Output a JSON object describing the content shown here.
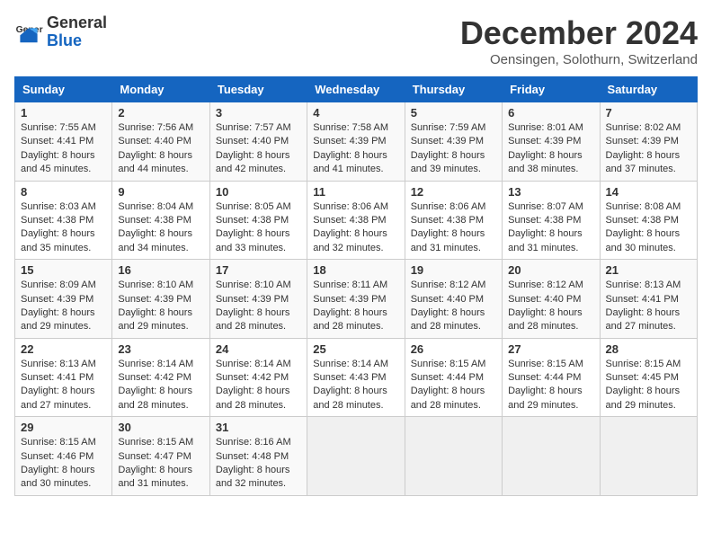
{
  "logo": {
    "general": "General",
    "blue": "Blue"
  },
  "header": {
    "month": "December 2024",
    "location": "Oensingen, Solothurn, Switzerland"
  },
  "weekdays": [
    "Sunday",
    "Monday",
    "Tuesday",
    "Wednesday",
    "Thursday",
    "Friday",
    "Saturday"
  ],
  "weeks": [
    [
      {
        "day": "1",
        "sunrise": "7:55 AM",
        "sunset": "4:41 PM",
        "daylight": "8 hours and 45 minutes."
      },
      {
        "day": "2",
        "sunrise": "7:56 AM",
        "sunset": "4:40 PM",
        "daylight": "8 hours and 44 minutes."
      },
      {
        "day": "3",
        "sunrise": "7:57 AM",
        "sunset": "4:40 PM",
        "daylight": "8 hours and 42 minutes."
      },
      {
        "day": "4",
        "sunrise": "7:58 AM",
        "sunset": "4:39 PM",
        "daylight": "8 hours and 41 minutes."
      },
      {
        "day": "5",
        "sunrise": "7:59 AM",
        "sunset": "4:39 PM",
        "daylight": "8 hours and 39 minutes."
      },
      {
        "day": "6",
        "sunrise": "8:01 AM",
        "sunset": "4:39 PM",
        "daylight": "8 hours and 38 minutes."
      },
      {
        "day": "7",
        "sunrise": "8:02 AM",
        "sunset": "4:39 PM",
        "daylight": "8 hours and 37 minutes."
      }
    ],
    [
      {
        "day": "8",
        "sunrise": "8:03 AM",
        "sunset": "4:38 PM",
        "daylight": "8 hours and 35 minutes."
      },
      {
        "day": "9",
        "sunrise": "8:04 AM",
        "sunset": "4:38 PM",
        "daylight": "8 hours and 34 minutes."
      },
      {
        "day": "10",
        "sunrise": "8:05 AM",
        "sunset": "4:38 PM",
        "daylight": "8 hours and 33 minutes."
      },
      {
        "day": "11",
        "sunrise": "8:06 AM",
        "sunset": "4:38 PM",
        "daylight": "8 hours and 32 minutes."
      },
      {
        "day": "12",
        "sunrise": "8:06 AM",
        "sunset": "4:38 PM",
        "daylight": "8 hours and 31 minutes."
      },
      {
        "day": "13",
        "sunrise": "8:07 AM",
        "sunset": "4:38 PM",
        "daylight": "8 hours and 31 minutes."
      },
      {
        "day": "14",
        "sunrise": "8:08 AM",
        "sunset": "4:38 PM",
        "daylight": "8 hours and 30 minutes."
      }
    ],
    [
      {
        "day": "15",
        "sunrise": "8:09 AM",
        "sunset": "4:39 PM",
        "daylight": "8 hours and 29 minutes."
      },
      {
        "day": "16",
        "sunrise": "8:10 AM",
        "sunset": "4:39 PM",
        "daylight": "8 hours and 29 minutes."
      },
      {
        "day": "17",
        "sunrise": "8:10 AM",
        "sunset": "4:39 PM",
        "daylight": "8 hours and 28 minutes."
      },
      {
        "day": "18",
        "sunrise": "8:11 AM",
        "sunset": "4:39 PM",
        "daylight": "8 hours and 28 minutes."
      },
      {
        "day": "19",
        "sunrise": "8:12 AM",
        "sunset": "4:40 PM",
        "daylight": "8 hours and 28 minutes."
      },
      {
        "day": "20",
        "sunrise": "8:12 AM",
        "sunset": "4:40 PM",
        "daylight": "8 hours and 28 minutes."
      },
      {
        "day": "21",
        "sunrise": "8:13 AM",
        "sunset": "4:41 PM",
        "daylight": "8 hours and 27 minutes."
      }
    ],
    [
      {
        "day": "22",
        "sunrise": "8:13 AM",
        "sunset": "4:41 PM",
        "daylight": "8 hours and 27 minutes."
      },
      {
        "day": "23",
        "sunrise": "8:14 AM",
        "sunset": "4:42 PM",
        "daylight": "8 hours and 28 minutes."
      },
      {
        "day": "24",
        "sunrise": "8:14 AM",
        "sunset": "4:42 PM",
        "daylight": "8 hours and 28 minutes."
      },
      {
        "day": "25",
        "sunrise": "8:14 AM",
        "sunset": "4:43 PM",
        "daylight": "8 hours and 28 minutes."
      },
      {
        "day": "26",
        "sunrise": "8:15 AM",
        "sunset": "4:44 PM",
        "daylight": "8 hours and 28 minutes."
      },
      {
        "day": "27",
        "sunrise": "8:15 AM",
        "sunset": "4:44 PM",
        "daylight": "8 hours and 29 minutes."
      },
      {
        "day": "28",
        "sunrise": "8:15 AM",
        "sunset": "4:45 PM",
        "daylight": "8 hours and 29 minutes."
      }
    ],
    [
      {
        "day": "29",
        "sunrise": "8:15 AM",
        "sunset": "4:46 PM",
        "daylight": "8 hours and 30 minutes."
      },
      {
        "day": "30",
        "sunrise": "8:15 AM",
        "sunset": "4:47 PM",
        "daylight": "8 hours and 31 minutes."
      },
      {
        "day": "31",
        "sunrise": "8:16 AM",
        "sunset": "4:48 PM",
        "daylight": "8 hours and 32 minutes."
      },
      null,
      null,
      null,
      null
    ]
  ]
}
